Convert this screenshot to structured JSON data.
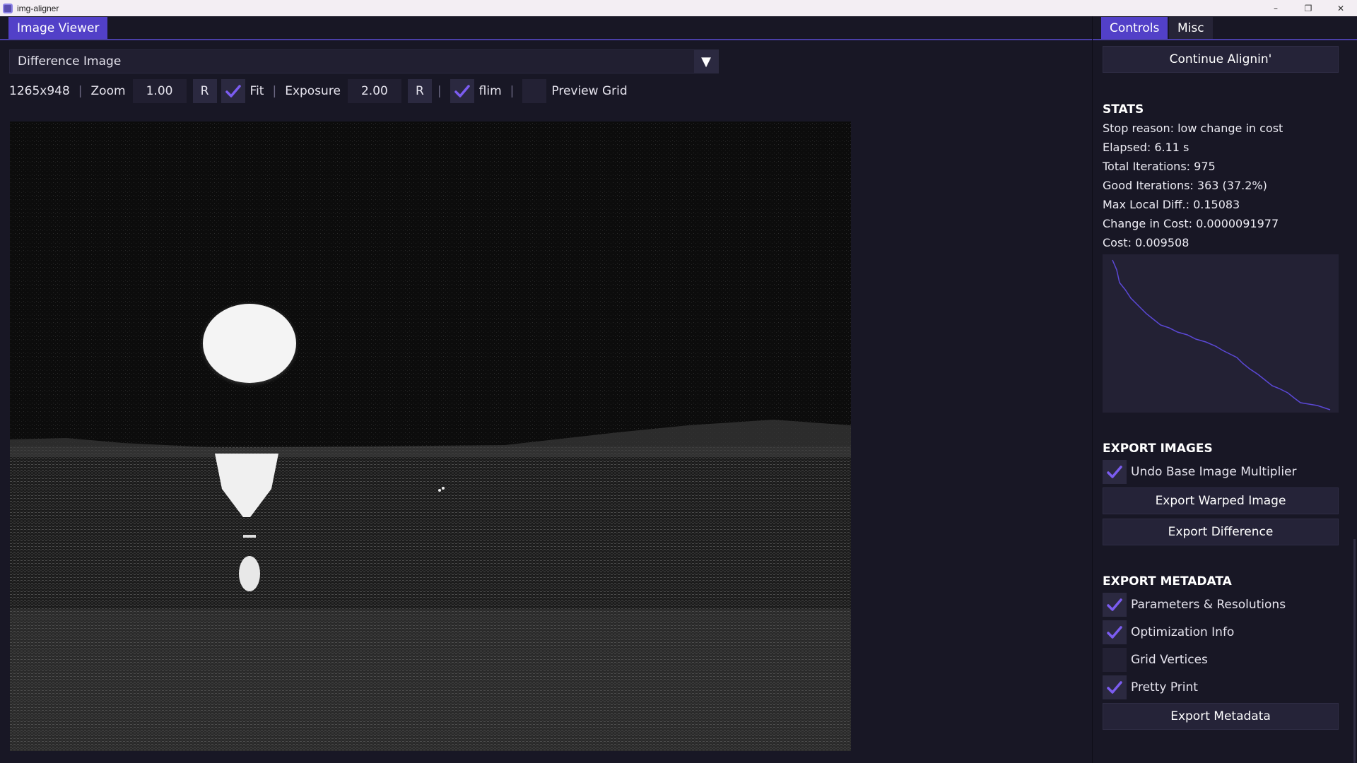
{
  "window": {
    "title": "img-aligner",
    "minimize_glyph": "–",
    "restore_glyph": "❐",
    "close_glyph": "✕"
  },
  "viewer": {
    "tab_label": "Image Viewer",
    "dropdown_value": "Difference Image",
    "dropdown_arrow": "▼",
    "resolution": "1265x948",
    "zoom_label": "Zoom",
    "zoom_value": "1.00",
    "zoom_reset": "R",
    "fit_label": "Fit",
    "fit_checked": true,
    "exposure_label": "Exposure",
    "exposure_value": "2.00",
    "exposure_reset": "R",
    "flim_label": "flim",
    "flim_checked": true,
    "preview_grid_label": "Preview Grid",
    "preview_grid_checked": false,
    "separator": "|"
  },
  "controls": {
    "tabs": [
      {
        "label": "Controls",
        "active": true
      },
      {
        "label": "Misc",
        "active": false
      }
    ],
    "continue_button": "Continue Alignin'",
    "stats": {
      "title": "STATS",
      "lines": [
        "Stop reason: low change in cost",
        "Elapsed: 6.11 s",
        "Total Iterations: 975",
        "Good Iterations: 363 (37.2%)",
        "Max Local Diff.: 0.15083",
        "Change in Cost: 0.0000091977",
        "Cost: 0.009508"
      ]
    },
    "export_images": {
      "title": "EXPORT IMAGES",
      "undo_base_label": "Undo Base Image Multiplier",
      "undo_base_checked": true,
      "export_warped_button": "Export Warped Image",
      "export_difference_button": "Export Difference"
    },
    "export_metadata": {
      "title": "EXPORT METADATA",
      "options": [
        {
          "label": "Parameters & Resolutions",
          "checked": true
        },
        {
          "label": "Optimization Info",
          "checked": true
        },
        {
          "label": "Grid Vertices",
          "checked": false
        },
        {
          "label": "Pretty Print",
          "checked": true
        }
      ],
      "export_button": "Export Metadata"
    }
  },
  "colors": {
    "accent": "#5240c8",
    "check": "#7b5cf0",
    "panel_bg": "#181725",
    "plot_line": "#5b48d6"
  }
}
